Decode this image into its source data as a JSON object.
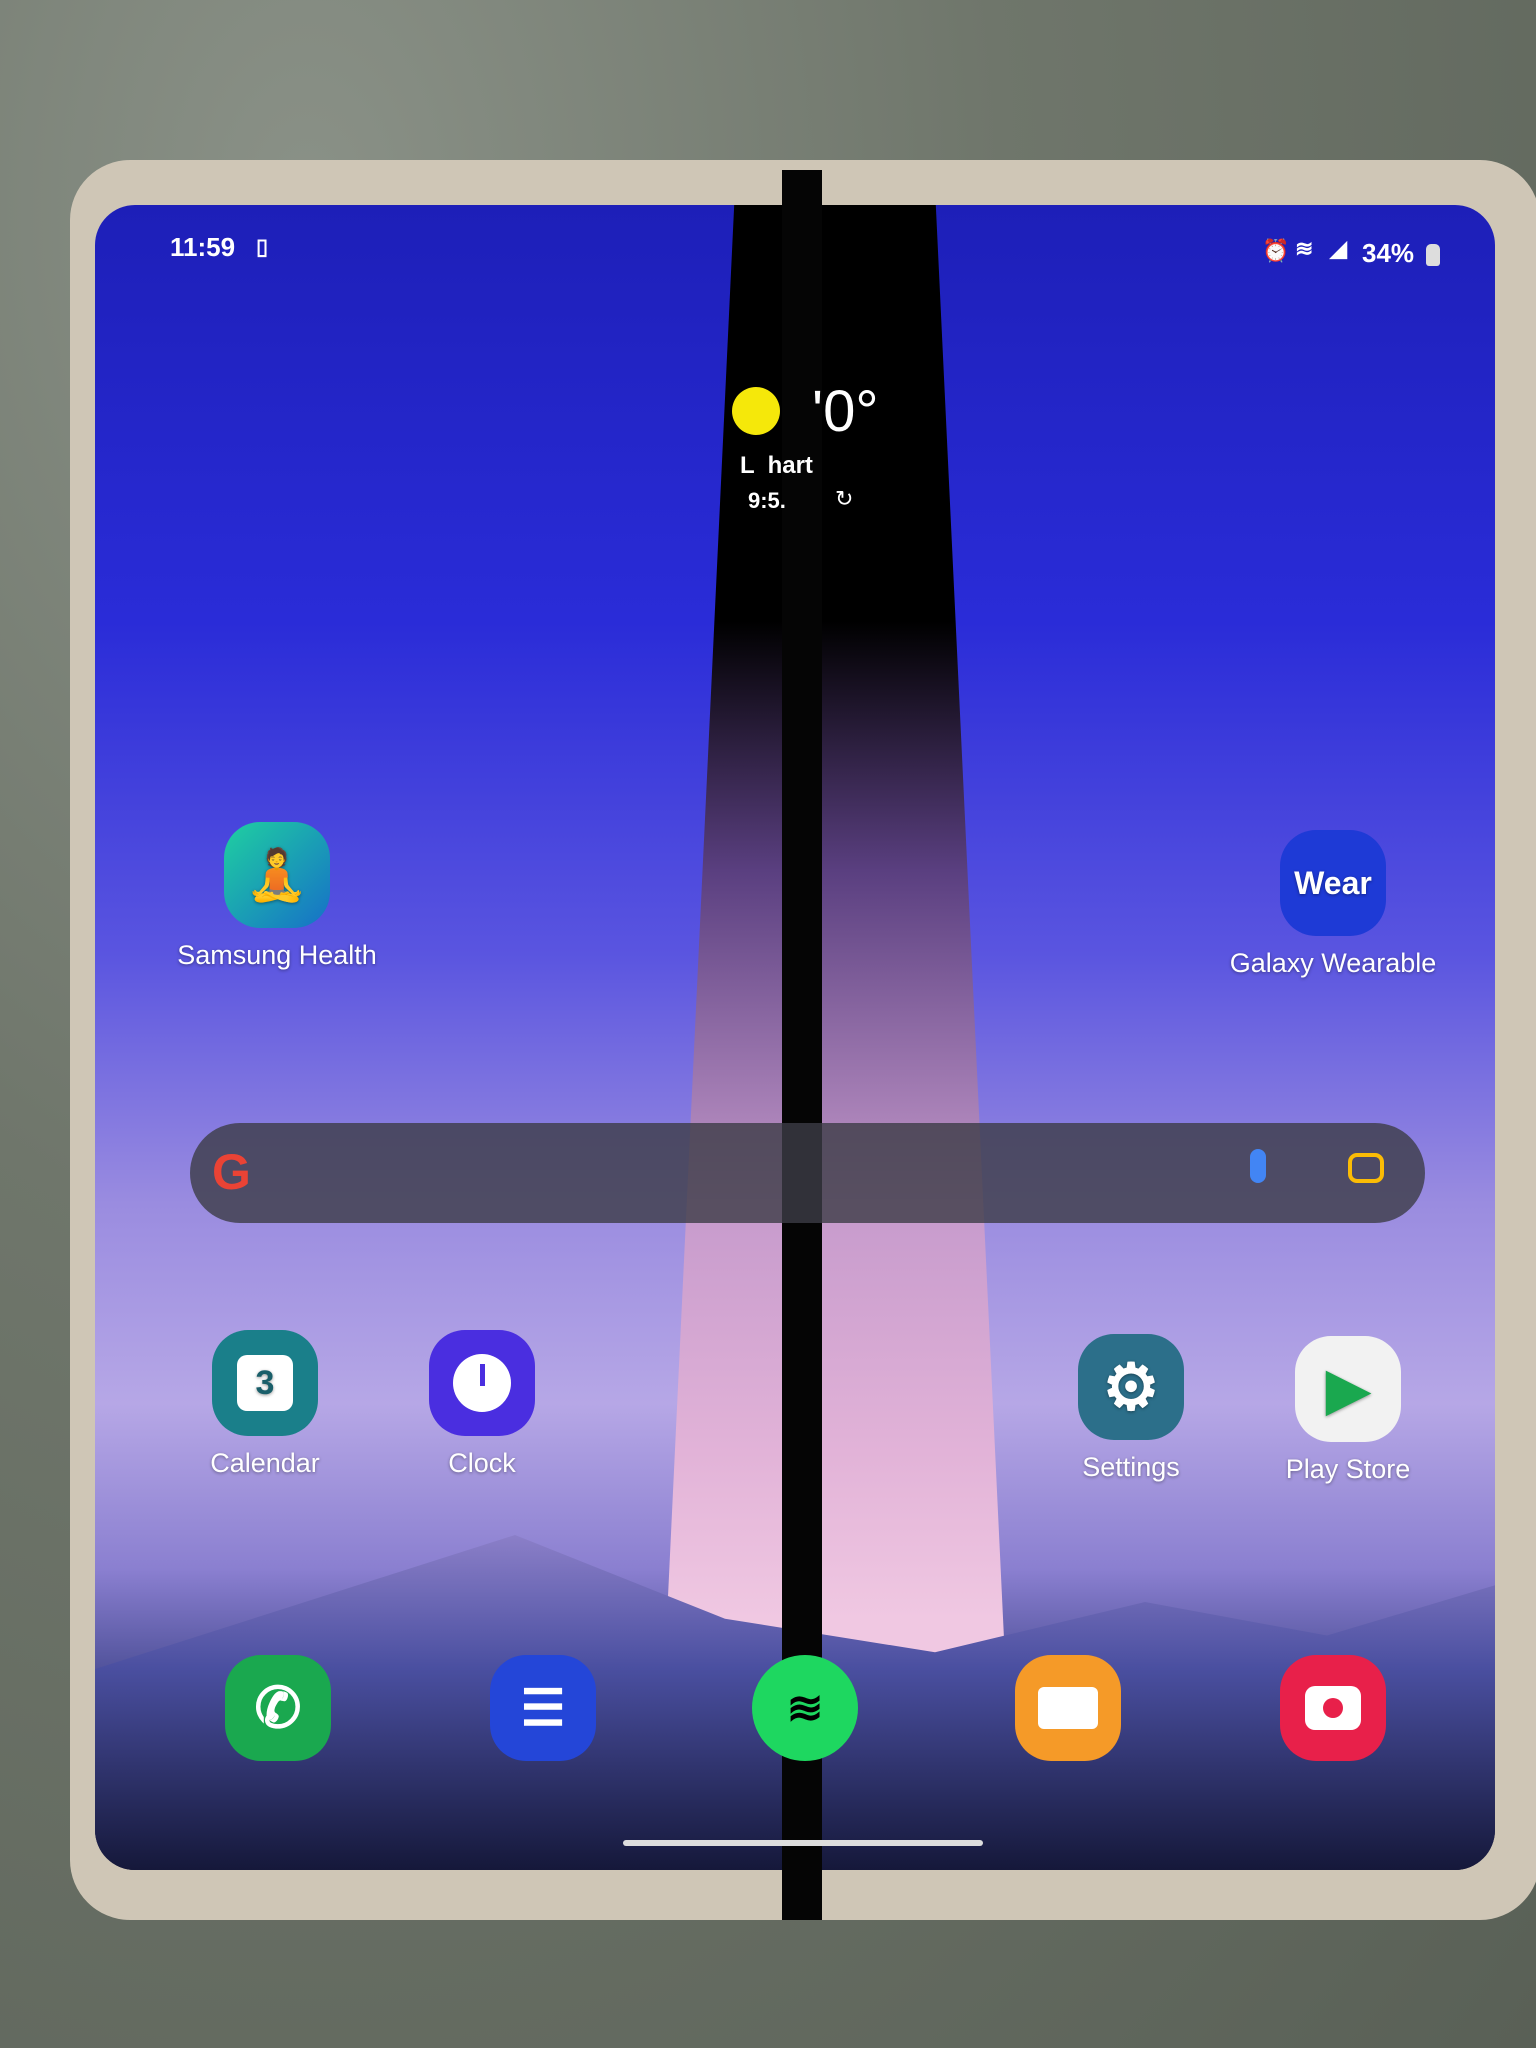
{
  "status_bar": {
    "time": "11:59",
    "battery": "34%",
    "icons": [
      "sim-icon",
      "alarm-icon",
      "wifi-icon",
      "signal-icon",
      "battery-icon"
    ]
  },
  "weather_widget": {
    "temperature": "'0°",
    "location": "L  hart",
    "updated": "9:5.",
    "icon": "sun-icon",
    "sun_color": "#f5e80a"
  },
  "apps": [
    {
      "label": "Samsung Health",
      "icon": "samsung-health-icon",
      "color": "#12a37f"
    },
    {
      "label": "Galaxy Wearable",
      "icon_text": "Wear",
      "icon": "galaxy-wearable-icon",
      "color": "#1e3ad6"
    },
    {
      "label": "Calendar",
      "icon_text": "3",
      "icon": "calendar-icon",
      "color": "#1a7f8a"
    },
    {
      "label": "Clock",
      "icon": "clock-icon",
      "color": "#4a2ee0"
    },
    {
      "label": "Settings",
      "icon": "gear-icon",
      "color": "#2c6f8a"
    },
    {
      "label": "Play Store",
      "icon": "play-store-icon",
      "color": "#f2f2f2"
    }
  ],
  "search": {
    "icons": [
      "google-icon",
      "microphone-icon",
      "lens-icon"
    ]
  },
  "dock": [
    {
      "name": "phone",
      "icon": "phone-icon",
      "color": "#1aa84f"
    },
    {
      "name": "messages",
      "icon": "messages-icon",
      "color": "#2446d8"
    },
    {
      "name": "spotify",
      "icon": "spotify-icon",
      "color": "#1ed760"
    },
    {
      "name": "my-files",
      "icon": "folder-icon",
      "color": "#f59a28"
    },
    {
      "name": "camera",
      "icon": "camera-icon",
      "color": "#e8204a"
    }
  ]
}
